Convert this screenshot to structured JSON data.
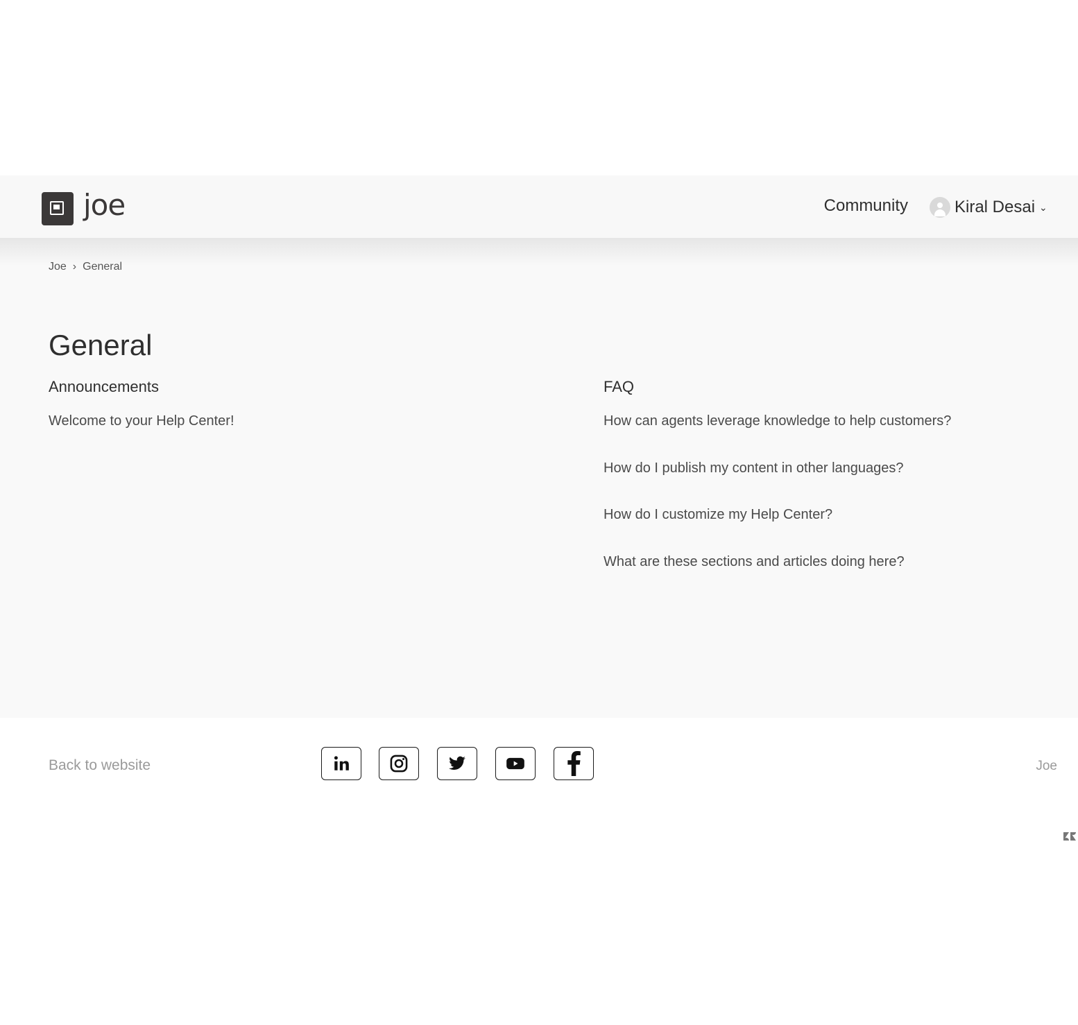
{
  "header": {
    "logo_text": "joe",
    "nav": {
      "community": "Community"
    },
    "user": {
      "name": "Kiral Desai",
      "chevron": "⌄"
    }
  },
  "breadcrumb": {
    "items": [
      "Joe",
      "General"
    ],
    "separator": "›"
  },
  "page": {
    "title": "General"
  },
  "sections": [
    {
      "title": "Announcements",
      "articles": [
        "Welcome to your Help Center!"
      ]
    },
    {
      "title": "FAQ",
      "articles": [
        "How can agents leverage knowledge to help customers?",
        "How do I publish my content in other languages?",
        "How do I customize my Help Center?",
        "What are these sections and articles doing here?"
      ]
    }
  ],
  "footer": {
    "back_link": "Back to website",
    "brand": "Joe",
    "social_icons": [
      "linkedin-icon",
      "instagram-icon",
      "twitter-icon",
      "youtube-icon",
      "facebook-icon"
    ]
  },
  "colors": {
    "text": "#2f2f2f",
    "muted": "#9a9a9a",
    "logo": "#3b3838",
    "header_bg": "#f8f8f8",
    "main_bg": "#f9f9f9"
  }
}
